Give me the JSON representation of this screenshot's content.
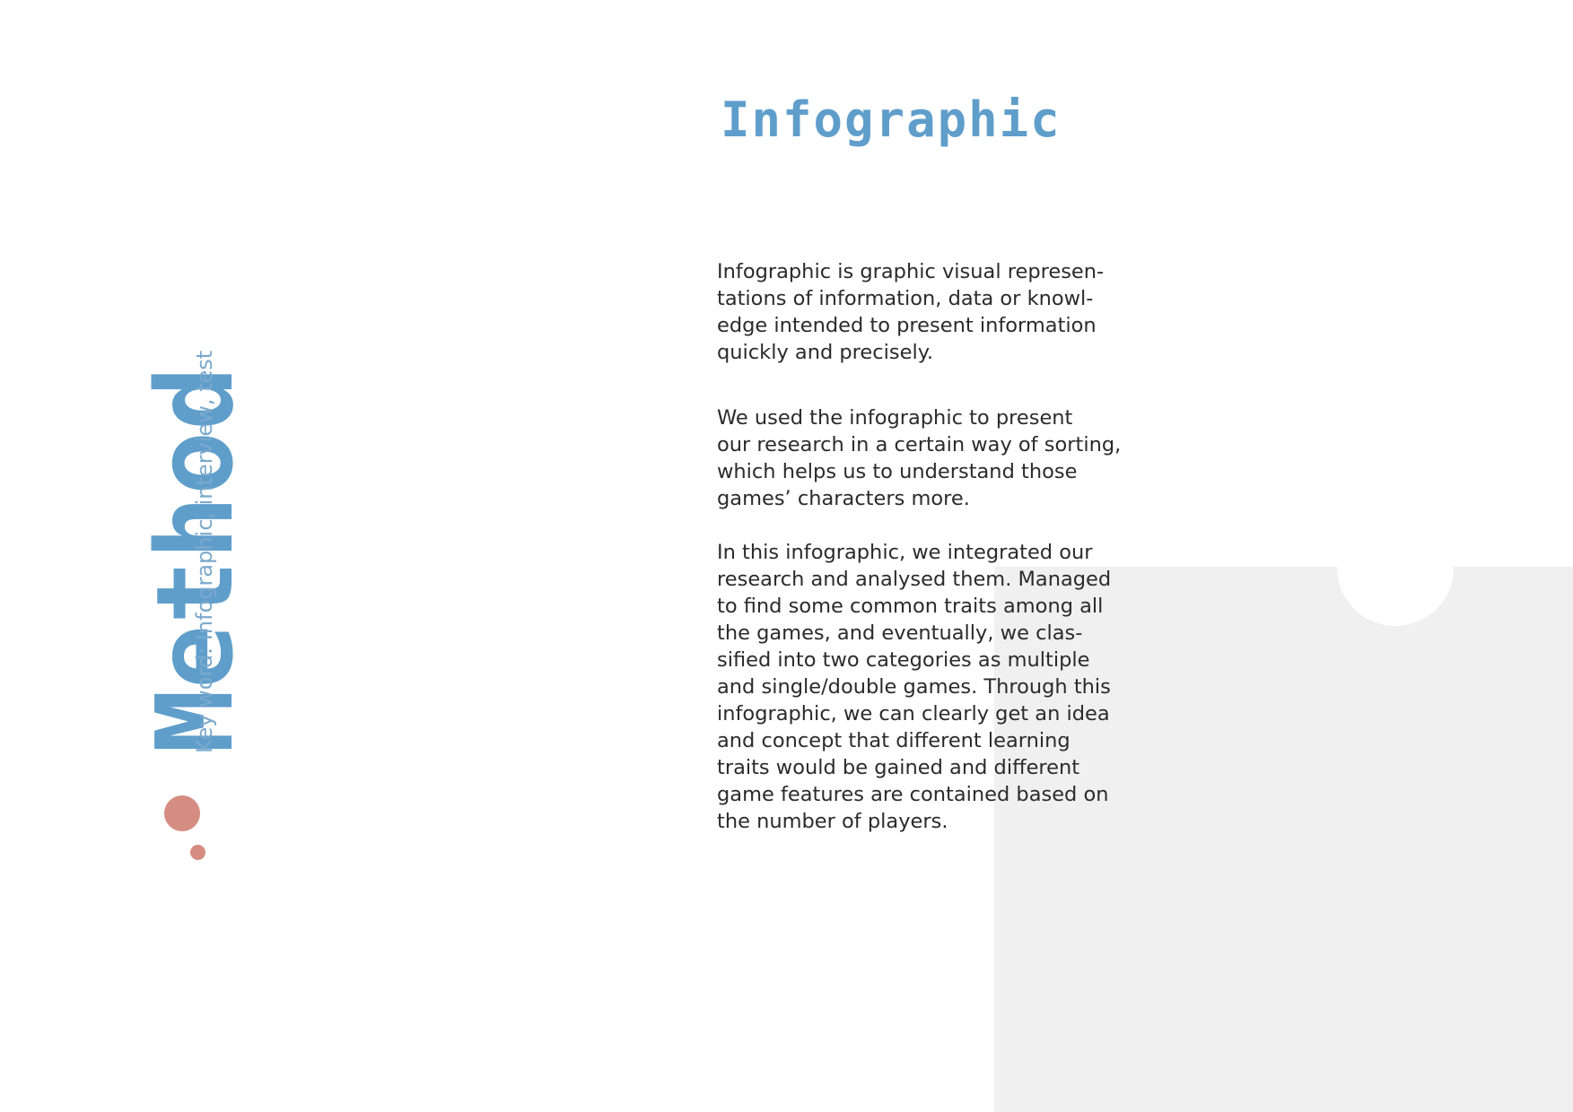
{
  "sidebar": {
    "title": "Method",
    "keywords": "Key word: Infographic, interview, test"
  },
  "main": {
    "title": "Infographic",
    "paragraphs": [
      "Infographic is graphic visual represen-\ntations of information, data or knowl-\nedge intended to present information\nquickly and precisely.",
      "We used the infographic to present\nour research in a certain way of sorting,\nwhich helps us to understand those\ngames’ characters more.",
      "In this infographic, we integrated our\nresearch and analysed them. Managed\nto find some common traits among all\nthe games, and eventually, we clas-\nsified into two categories as multiple\nand single/double games. Through this\ninfographic, we can clearly get an idea\nand concept that different learning\ntraits would be gained and different\ngame features are contained based on\nthe number of players."
    ]
  },
  "colors": {
    "accent_blue": "#5f9ecb",
    "keyword_blue": "#7ba9cc",
    "dot_salmon": "#d58c81",
    "panel_gray": "#f0f0f0",
    "text_dark": "#2b2b2b"
  }
}
